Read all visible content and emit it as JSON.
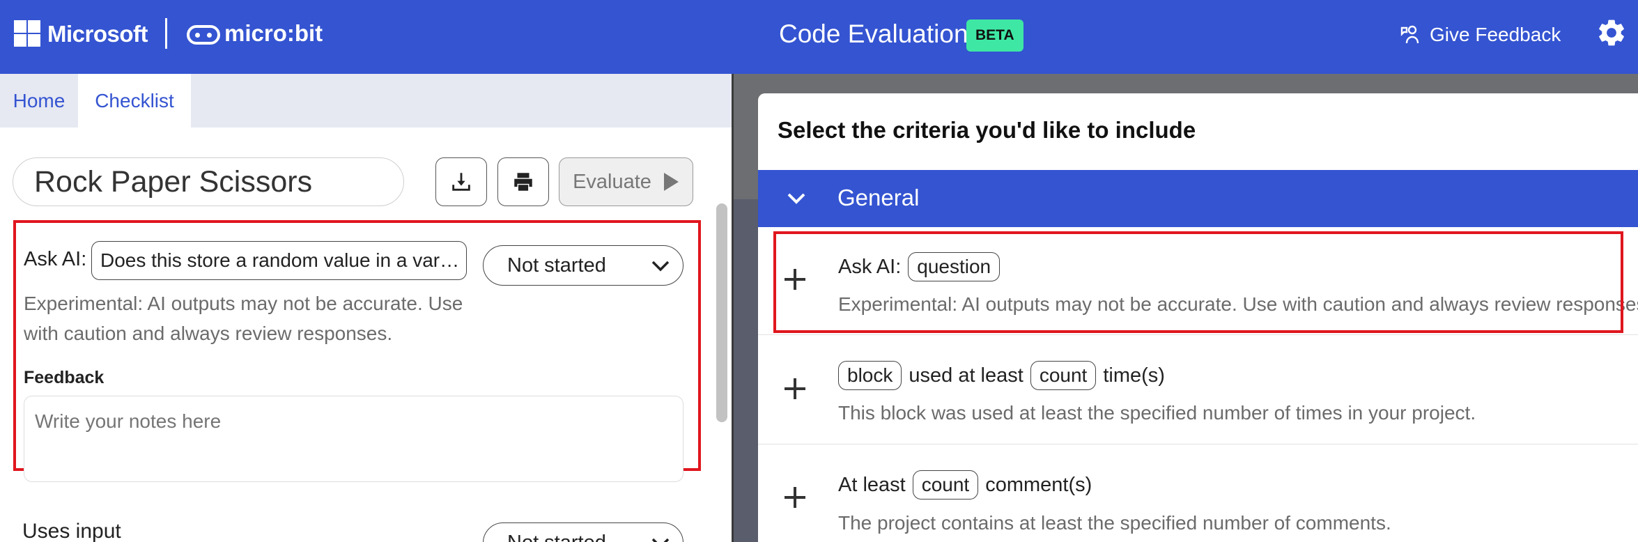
{
  "header": {
    "brand": "Microsoft",
    "product": "micro:bit",
    "app_title": "Code Evaluation",
    "badge": "BETA",
    "feedback_label": "Give Feedback"
  },
  "tabs": [
    {
      "label": "Home"
    },
    {
      "label": "Checklist"
    }
  ],
  "checklist": {
    "title": "Rock Paper Scissors",
    "evaluate_label": "Evaluate",
    "criteria": [
      {
        "prefix": "Ask AI:",
        "question": "Does this store a random value in a var…",
        "status": "Not started",
        "note": "Experimental: AI outputs may not be accurate. Use with caution and always review responses.",
        "feedback_label": "Feedback",
        "feedback_placeholder": "Write your notes here"
      },
      {
        "label": "Uses input",
        "status": "Not started"
      }
    ]
  },
  "modal": {
    "title": "Select the criteria you'd like to include",
    "category": "General",
    "items": [
      {
        "prefix": "Ask AI:",
        "pill": "question",
        "description": "Experimental: AI outputs may not be accurate. Use with caution and always review responses."
      },
      {
        "pill1": "block",
        "middle": "used at least",
        "pill2": "count",
        "suffix": "time(s)",
        "description": "This block was used at least the specified number of times in your project."
      },
      {
        "prefix": "At least",
        "pill": "count",
        "suffix": "comment(s)",
        "description": "The project contains at least the specified number of comments."
      }
    ]
  },
  "colors": {
    "primary": "#3454d1",
    "beta_badge": "#3ee8a4",
    "highlight": "#e0161e"
  }
}
